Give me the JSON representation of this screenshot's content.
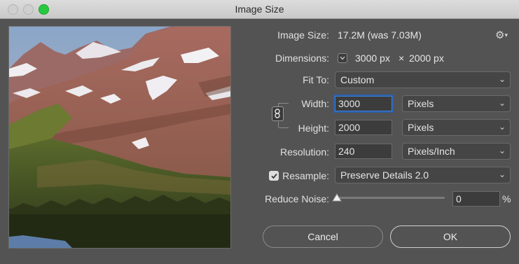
{
  "window": {
    "title": "Image Size"
  },
  "image_size": {
    "label": "Image Size:",
    "value": "17.2M (was 7.03M)"
  },
  "dimensions": {
    "label": "Dimensions:",
    "width": "3000 px",
    "times": "×",
    "height": "2000 px"
  },
  "fit_to": {
    "label": "Fit To:",
    "value": "Custom"
  },
  "width": {
    "label": "Width:",
    "value": "3000",
    "unit": "Pixels"
  },
  "height": {
    "label": "Height:",
    "value": "2000",
    "unit": "Pixels"
  },
  "resolution": {
    "label": "Resolution:",
    "value": "240",
    "unit": "Pixels/Inch"
  },
  "resample": {
    "label": "Resample:",
    "checked": true,
    "value": "Preserve Details 2.0"
  },
  "reduce_noise": {
    "label": "Reduce Noise:",
    "value": "0",
    "unit": "%"
  },
  "buttons": {
    "cancel": "Cancel",
    "ok": "OK"
  },
  "icons": {
    "gear": "gear-icon",
    "link": "link-icon",
    "chevron": "chevron-down-icon"
  },
  "colors": {
    "accent": "#3f7fd6",
    "zoom": "#27c93f"
  }
}
